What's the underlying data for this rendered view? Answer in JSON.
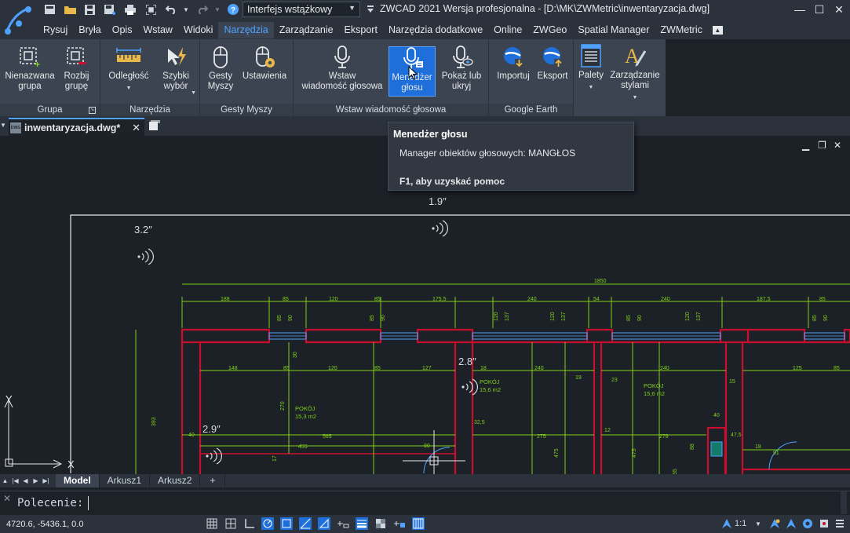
{
  "titlebar": {
    "workspace": "Interfejs wstążkowy",
    "title": "ZWCAD 2021 Wersja profesjonalna - [D:\\MK\\ZWMetric\\inwentaryzacja.dwg]",
    "minimize": "—",
    "maximize": "☐",
    "close": "✕"
  },
  "menu": [
    "Rysuj",
    "Bryła",
    "Opis",
    "Wstaw",
    "Widoki",
    "Narzędzia",
    "Zarządzanie",
    "Eksport",
    "Narzędzia dodatkowe",
    "Online",
    "ZWGeo",
    "Spatial Manager",
    "ZWMetric"
  ],
  "ribbon": {
    "panels": [
      {
        "title": "Grupa",
        "buttons": [
          "Nienazwana\ngrupa",
          "Rozbij\ngrupę"
        ]
      },
      {
        "title": "Narzędzia",
        "buttons": [
          "Odległość",
          "Szybki\nwybór"
        ]
      },
      {
        "title": "Gesty Myszy",
        "buttons": [
          "Gesty\nMyszy",
          "Ustawienia"
        ]
      },
      {
        "title": "Wstaw wiadomość głosowa",
        "buttons": [
          "Wstaw\nwiadomość głosowa",
          "Menedżer\ngłosu",
          "Pokaż lub\nukryj"
        ]
      },
      {
        "title": "Google Earth",
        "buttons": [
          "Importuj",
          "Eksport"
        ]
      },
      {
        "title": "",
        "buttons": [
          "Palety",
          "Zarządzanie\nstylami"
        ]
      }
    ]
  },
  "document_tab": {
    "filetype": "DWG",
    "name": "inwentaryzacja.dwg*",
    "close": "✕"
  },
  "tooltip": {
    "title": "Menedżer głosu",
    "description": "Manager obiektów głosowych: MANGŁOS",
    "help": "F1, aby uzyskać pomoc"
  },
  "drawing": {
    "voice_notes": [
      "1.9″",
      "3.2″",
      "2.8″",
      "2.9″"
    ],
    "dims_top": {
      "total": "1850",
      "row1": [
        "188",
        "85",
        "120",
        "85",
        "175,5",
        "240",
        "54",
        "240",
        "187,5",
        "85"
      ]
    },
    "dims_vertical": [
      "85",
      "90",
      "85",
      "90",
      "120",
      "137",
      "120",
      "137",
      "85",
      "90",
      "120",
      "137",
      "85",
      "90"
    ],
    "dims_inner_row": [
      "148",
      "85",
      "120",
      "85",
      "127",
      "18",
      "240",
      "240",
      "125",
      "85"
    ],
    "rooms": [
      {
        "name": "POKÓJ",
        "area": "15,3 m2"
      },
      {
        "name": "POKÓJ",
        "area": "15,6 m2"
      },
      {
        "name": "POKÓJ",
        "area": "15,6 m2"
      }
    ],
    "misc_dims": [
      "30",
      "270",
      "393",
      "40",
      "565",
      "455",
      "17",
      "90",
      "32,5",
      "275",
      "12",
      "278",
      "19",
      "23",
      "15",
      "40",
      "47,5",
      "18",
      "91",
      "475",
      "475",
      "88",
      "55"
    ],
    "axis_x": "X",
    "axis_y": "Y"
  },
  "layout_tabs": [
    "Model",
    "Arkusz1",
    "Arkusz2",
    "+"
  ],
  "command": {
    "prompt": "Polecenie:",
    "value": ""
  },
  "status": {
    "coords": "4720.6, -5436.1, 0.0",
    "scale": "1:1"
  },
  "colors": {
    "wall": "#c8102e",
    "dimension": "#7fd11a",
    "text": "#d6dbe0",
    "accent": "#1e6fd9"
  }
}
